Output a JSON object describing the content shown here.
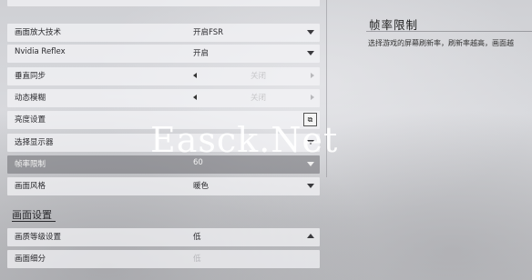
{
  "watermark": "Easck.Net",
  "rows": [
    {
      "label": "画面放大技术",
      "value": "开启FSR"
    },
    {
      "label": "Nvidia Reflex",
      "value": "开启"
    },
    {
      "label": "垂直同步",
      "value": "关闭"
    },
    {
      "label": "动态模糊",
      "value": "关闭"
    },
    {
      "label": "亮度设置",
      "value": ""
    },
    {
      "label": "选择显示器",
      "value": ""
    },
    {
      "label": "帧率限制",
      "value": "60"
    },
    {
      "label": "画面风格",
      "value": "暖色"
    }
  ],
  "section_title": "画面设置",
  "section_rows": [
    {
      "label": "画质等级设置",
      "value": "低"
    },
    {
      "label": "画面细分",
      "value": "低"
    }
  ],
  "detail": {
    "title": "帧率限制",
    "description": "选择游戏的屏幕刷新率，刷新率越高，画面越"
  },
  "colors": {
    "highlight": "#6e6e73",
    "panel": "#f4f4f6"
  }
}
